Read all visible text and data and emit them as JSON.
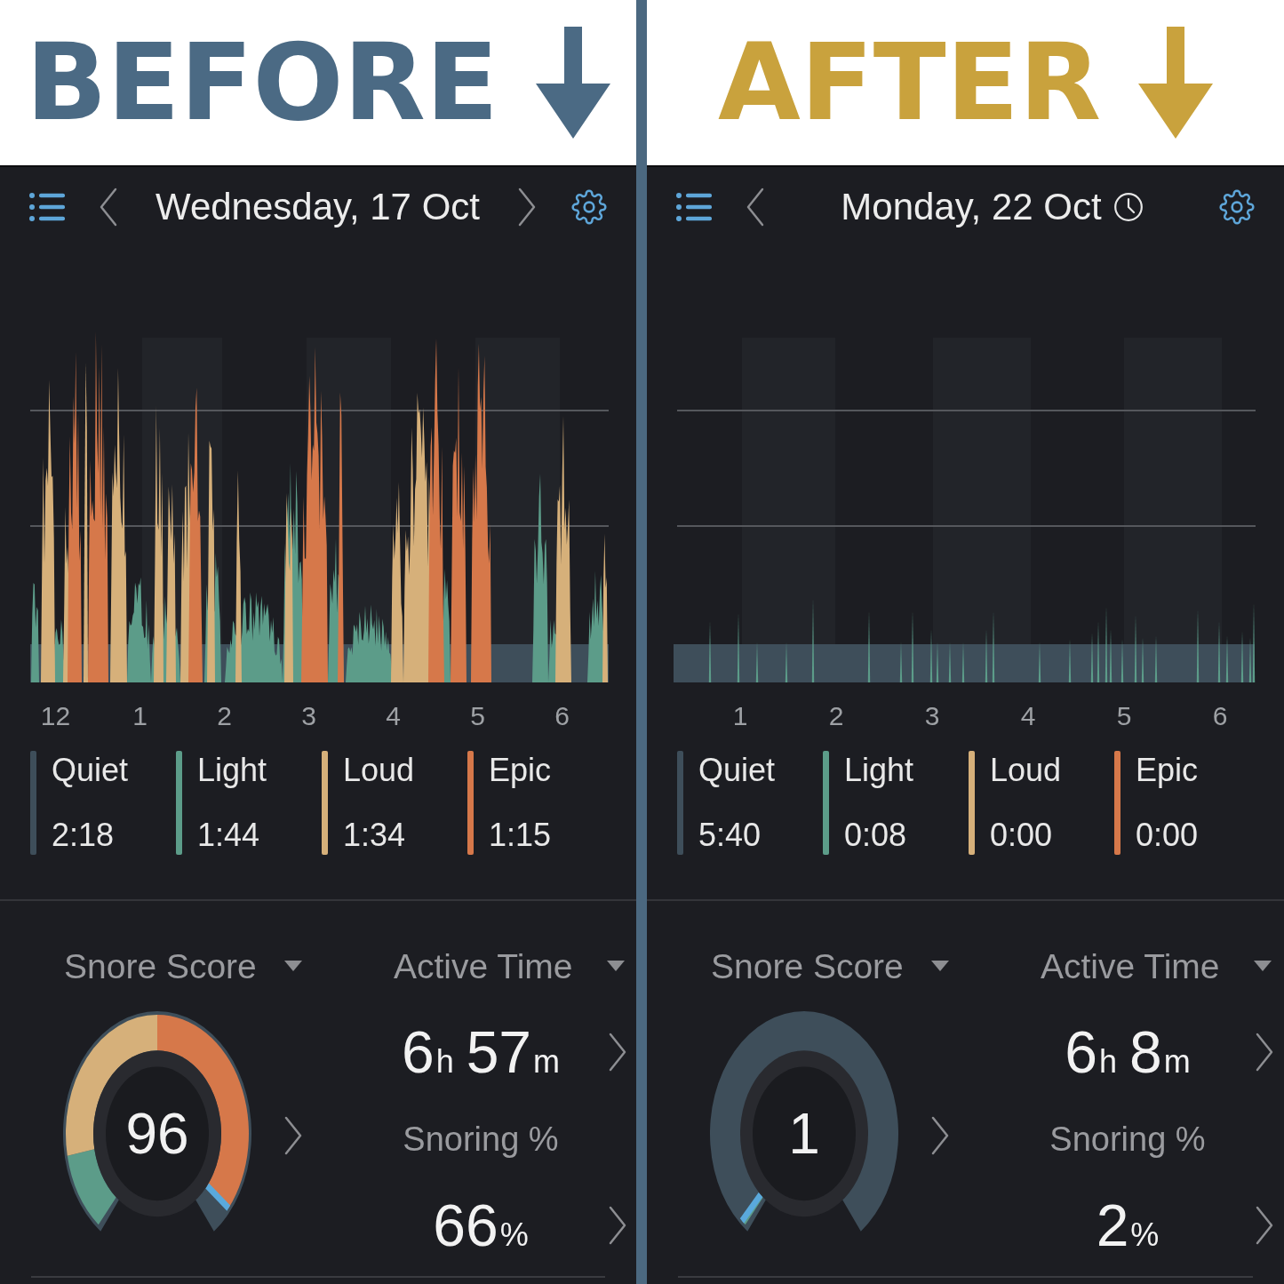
{
  "panels": [
    {
      "banner": {
        "label": "BEFORE",
        "color": "#4b6a84"
      },
      "header": {
        "title": "Wednesday, 17 Oct",
        "next_day": true,
        "timer": false
      },
      "chart": {
        "x_labels": [
          "12",
          "1",
          "2",
          "3",
          "4",
          "5",
          "6"
        ]
      },
      "legend": [
        {
          "label": "Quiet",
          "value": "2:18",
          "color": "#3e4e5a"
        },
        {
          "label": "Light",
          "value": "1:44",
          "color": "#5c9c89"
        },
        {
          "label": "Loud",
          "value": "1:34",
          "color": "#d6b07a"
        },
        {
          "label": "Epic",
          "value": "1:15",
          "color": "#d6784a"
        }
      ],
      "snore_score": {
        "label": "Snore Score",
        "score": "96",
        "level": 0.96
      },
      "active_time": {
        "label": "Active Time",
        "value": [
          {
            "number": "6",
            "unit": "h"
          },
          {
            "number": "57",
            "unit": "m"
          }
        ]
      },
      "snoring": {
        "label": "Snoring %",
        "value": [
          {
            "number": "66",
            "unit": "%"
          }
        ]
      }
    },
    {
      "banner": {
        "label": "AFTER",
        "color": "#c9a23d"
      },
      "header": {
        "title": "Monday, 22 Oct",
        "next_day": false,
        "timer": true
      },
      "chart": {
        "x_labels": [
          "1",
          "2",
          "3",
          "4",
          "5",
          "6"
        ]
      },
      "legend": [
        {
          "label": "Quiet",
          "value": "5:40",
          "color": "#3e4e5a"
        },
        {
          "label": "Light",
          "value": "0:08",
          "color": "#5c9c89"
        },
        {
          "label": "Loud",
          "value": "0:00",
          "color": "#d6b07a"
        },
        {
          "label": "Epic",
          "value": "0:00",
          "color": "#d6784a"
        }
      ],
      "snore_score": {
        "label": "Snore Score",
        "score": "1",
        "level": 0.01
      },
      "active_time": {
        "label": "Active Time",
        "value": [
          {
            "number": "6",
            "unit": "h"
          },
          {
            "number": "8",
            "unit": "m"
          }
        ]
      },
      "snoring": {
        "label": "Snoring %",
        "value": [
          {
            "number": "2",
            "unit": "%"
          }
        ]
      }
    }
  ]
}
